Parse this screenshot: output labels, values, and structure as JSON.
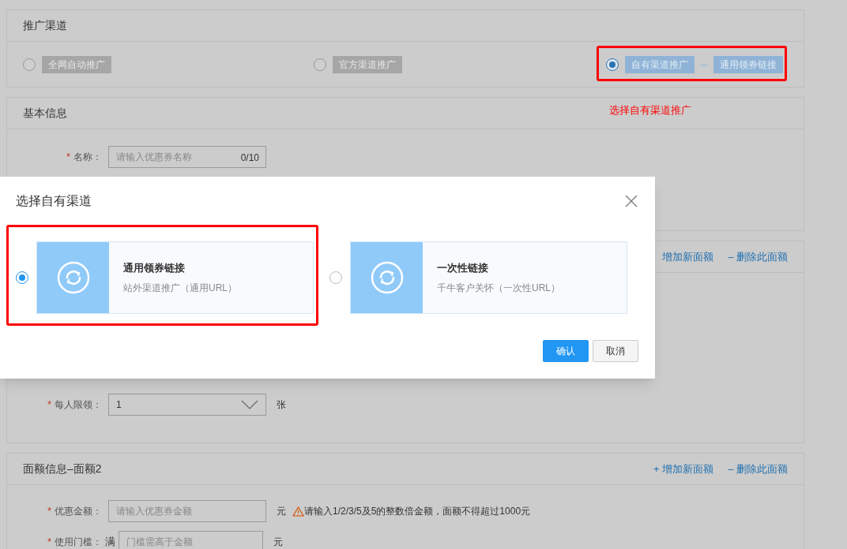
{
  "channel_section": {
    "title": "推广渠道",
    "options": [
      {
        "label": "全网自动推广",
        "selected": false
      },
      {
        "label": "官方渠道推广",
        "selected": false
      },
      {
        "label": "自有渠道推广",
        "selected": true,
        "sub_label": "通用领券链接"
      }
    ]
  },
  "annotation": "选择自有渠道推广",
  "basic_section": {
    "title": "基本信息",
    "fields": [
      {
        "label": "名称：",
        "required_mark": "*",
        "kind": "input",
        "placeholder": "请输入优惠券名称",
        "counter": "0/10"
      }
    ]
  },
  "denomination_section_1": {
    "actions": [
      "增加新面额",
      "– 删除此面额"
    ],
    "fields": [
      {
        "label": "每人限领：",
        "required_mark": "*",
        "kind": "select",
        "value": "1",
        "unit": "张"
      }
    ]
  },
  "denomination_section_2": {
    "title": "面额信息–面额2",
    "actions": [
      "+ 增加新面额",
      "– 删除此面额"
    ],
    "fields": [
      {
        "label": "优惠金额：",
        "required_mark": "*",
        "kind": "input",
        "placeholder": "请输入优惠券金额",
        "unit": "元",
        "warning": "请输入1/2/3/5及5的整数倍金额，面额不得超过1000元"
      },
      {
        "label": "使用门槛：",
        "required_mark": "*",
        "kind": "input",
        "prefix": "满",
        "placeholder": "门槛需高于金额",
        "unit": "元"
      }
    ]
  },
  "modal": {
    "title": "选择自有渠道",
    "options": [
      {
        "title": "通用领券链接",
        "subtitle": "站外渠道推广（通用URL）",
        "selected": true
      },
      {
        "title": "一次性链接",
        "subtitle": "千牛客户关怀（一次性URL）",
        "selected": false
      }
    ],
    "buttons": [
      {
        "label": "确认",
        "kind": "primary"
      },
      {
        "label": "取消",
        "kind": "default"
      }
    ]
  }
}
